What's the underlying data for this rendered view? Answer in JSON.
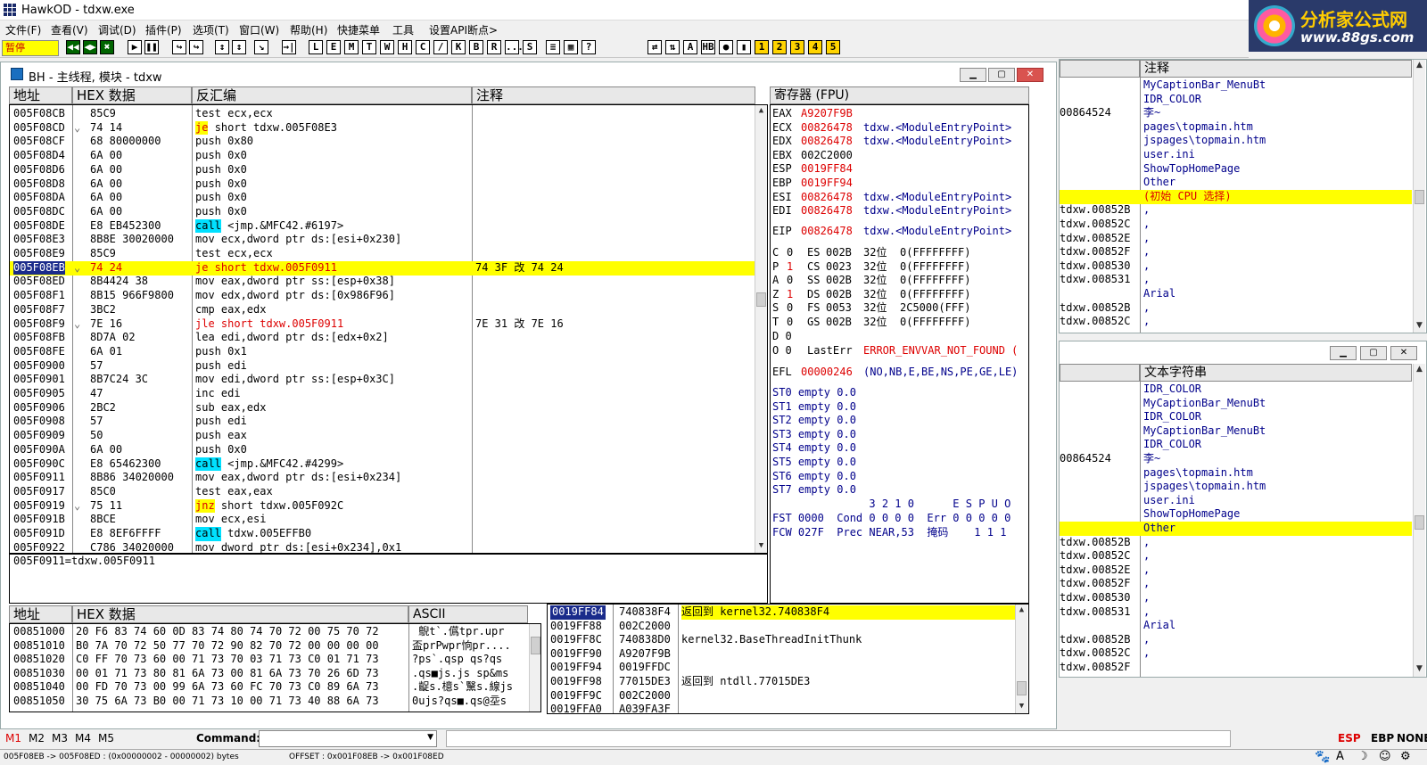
{
  "app": {
    "title": "HawkOD - tdxw.exe"
  },
  "menu": [
    "文件(F)",
    "查看(V)",
    "调试(D)",
    "插件(P)",
    "选项(T)",
    "窗口(W)",
    "帮助(H)",
    "快捷菜单",
    "工具",
    "设置API断点>"
  ],
  "toolbar": {
    "pause_label": "暂停",
    "buttons": [
      "◀◀",
      "◀▶",
      "✖",
      "▶",
      "❚❚",
      "↪",
      "↪",
      "↕",
      "↕",
      "↘",
      "→|",
      "L",
      "E",
      "M",
      "T",
      "W",
      "H",
      "C",
      "/",
      "K",
      "B",
      "R",
      "...",
      "S",
      "≡",
      "▦",
      "?",
      "⇄",
      "⇅",
      "A",
      "HB",
      "●",
      "▮",
      "1",
      "2",
      "3",
      "4",
      "5"
    ]
  },
  "logo": {
    "text1": "分析家公式网",
    "text2": "www.88gs.com"
  },
  "cpu_window": {
    "title": "BH - 主线程, 模块 - tdxw",
    "disasm_headers": {
      "addr": "地址",
      "hex": "HEX 数据",
      "disasm": "反汇编",
      "comment": "注释"
    },
    "rows": [
      {
        "addr": "005F08CB",
        "hex": "85C9",
        "asm": "test ecx,ecx",
        "cmt": ""
      },
      {
        "addr": "005F08CD",
        "arrow": "⌄",
        "hex": "74 14",
        "mn": "je",
        "mnstyle": "jmp",
        "ops": "short tdxw.005F08E3",
        "cmt": ""
      },
      {
        "addr": "005F08CF",
        "hex": "68 80000000",
        "asm": "push 0x80",
        "cmt": ""
      },
      {
        "addr": "005F08D4",
        "hex": "6A 00",
        "asm": "push 0x0",
        "cmt": ""
      },
      {
        "addr": "005F08D6",
        "hex": "6A 00",
        "asm": "push 0x0",
        "cmt": ""
      },
      {
        "addr": "005F08D8",
        "hex": "6A 00",
        "asm": "push 0x0",
        "cmt": ""
      },
      {
        "addr": "005F08DA",
        "hex": "6A 00",
        "asm": "push 0x0",
        "cmt": ""
      },
      {
        "addr": "005F08DC",
        "hex": "6A 00",
        "asm": "push 0x0",
        "cmt": ""
      },
      {
        "addr": "005F08DE",
        "hex": "E8 EB452300",
        "mn": "call",
        "mnstyle": "call",
        "ops": "<jmp.&MFC42.#6197>",
        "cmt": ""
      },
      {
        "addr": "005F08E3",
        "hex": "8B8E 30020000",
        "asm": "mov ecx,dword ptr ds:[esi+0x230]",
        "cmt": ""
      },
      {
        "addr": "005F08E9",
        "hex": "85C9",
        "asm": "test ecx,ecx",
        "cmt": ""
      },
      {
        "addr": "005F08EB",
        "arrow": "⌄",
        "hex": "74 24",
        "asm": "je short tdxw.005F0911",
        "cmt": "74 3F 改 74 24",
        "highlight": true
      },
      {
        "addr": "005F08ED",
        "hex": "8B4424 38",
        "asm": "mov eax,dword ptr ss:[esp+0x38]",
        "cmt": ""
      },
      {
        "addr": "005F08F1",
        "hex": "8B15 966F9800",
        "asm": "mov edx,dword ptr ds:[0x986F96]",
        "cmt": ""
      },
      {
        "addr": "005F08F7",
        "hex": "3BC2",
        "asm": "cmp eax,edx",
        "cmt": ""
      },
      {
        "addr": "005F08F9",
        "arrow": "⌄",
        "hex": "7E 16",
        "asm": "jle short tdxw.005F0911",
        "cmt": "7E 31 改 7E 16",
        "redline": true
      },
      {
        "addr": "005F08FB",
        "hex": "8D7A 02",
        "asm": "lea edi,dword ptr ds:[edx+0x2]",
        "cmt": ""
      },
      {
        "addr": "005F08FE",
        "hex": "6A 01",
        "asm": "push 0x1",
        "cmt": ""
      },
      {
        "addr": "005F0900",
        "hex": "57",
        "asm": "push edi",
        "cmt": ""
      },
      {
        "addr": "005F0901",
        "hex": "8B7C24 3C",
        "asm": "mov edi,dword ptr ss:[esp+0x3C]",
        "cmt": ""
      },
      {
        "addr": "005F0905",
        "hex": "47",
        "asm": "inc edi",
        "cmt": ""
      },
      {
        "addr": "005F0906",
        "hex": "2BC2",
        "asm": "sub eax,edx",
        "cmt": ""
      },
      {
        "addr": "005F0908",
        "hex": "57",
        "asm": "push edi",
        "cmt": ""
      },
      {
        "addr": "005F0909",
        "hex": "50",
        "asm": "push eax",
        "cmt": ""
      },
      {
        "addr": "005F090A",
        "hex": "6A 00",
        "asm": "push 0x0",
        "cmt": ""
      },
      {
        "addr": "005F090C",
        "hex": "E8 65462300",
        "mn": "call",
        "mnstyle": "call",
        "ops": "<jmp.&MFC42.#4299>",
        "cmt": ""
      },
      {
        "addr": "005F0911",
        "hex": "8B86 34020000",
        "asm": "mov eax,dword ptr ds:[esi+0x234]",
        "cmt": ""
      },
      {
        "addr": "005F0917",
        "hex": "85C0",
        "asm": "test eax,eax",
        "cmt": ""
      },
      {
        "addr": "005F0919",
        "arrow": "⌄",
        "hex": "75 11",
        "mn": "jnz",
        "mnstyle": "jmp",
        "ops": "short tdxw.005F092C",
        "cmt": ""
      },
      {
        "addr": "005F091B",
        "hex": "8BCE",
        "asm": "mov ecx,esi",
        "cmt": ""
      },
      {
        "addr": "005F091D",
        "hex": "E8 8EF6FFFF",
        "mn": "call",
        "mnstyle": "call",
        "ops": "tdxw.005EFFB0",
        "cmt": ""
      },
      {
        "addr": "005F0922",
        "hex": "C786 34020000",
        "asm": "mov dword ptr ds:[esi+0x234],0x1",
        "cmt": ""
      }
    ],
    "info_line": "005F0911=tdxw.005F0911",
    "reg_header": "寄存器 (FPU)",
    "regs": [
      {
        "n": "EAX",
        "v": "A9207F9B",
        "d": ""
      },
      {
        "n": "ECX",
        "v": "00826478",
        "d": "tdxw.<ModuleEntryPoint>"
      },
      {
        "n": "EDX",
        "v": "00826478",
        "d": "tdxw.<ModuleEntryPoint>"
      },
      {
        "n": "EBX",
        "v": "002C2000",
        "d": "",
        "black": true
      },
      {
        "n": "ESP",
        "v": "0019FF84",
        "d": ""
      },
      {
        "n": "EBP",
        "v": "0019FF94",
        "d": ""
      },
      {
        "n": "ESI",
        "v": "00826478",
        "d": "tdxw.<ModuleEntryPoint>"
      },
      {
        "n": "EDI",
        "v": "00826478",
        "d": "tdxw.<ModuleEntryPoint>"
      }
    ],
    "eip": {
      "n": "EIP",
      "v": "00826478",
      "d": "tdxw.<ModuleEntryPoint>"
    },
    "segs": [
      {
        "f": "C",
        "fv": "0",
        "s": "ES",
        "sv": "002B",
        "b": "32位",
        "r": "0(FFFFFFFF)"
      },
      {
        "f": "P",
        "fv": "1",
        "s": "CS",
        "sv": "0023",
        "b": "32位",
        "r": "0(FFFFFFFF)",
        "red": true
      },
      {
        "f": "A",
        "fv": "0",
        "s": "SS",
        "sv": "002B",
        "b": "32位",
        "r": "0(FFFFFFFF)"
      },
      {
        "f": "Z",
        "fv": "1",
        "s": "DS",
        "sv": "002B",
        "b": "32位",
        "r": "0(FFFFFFFF)",
        "red": true
      },
      {
        "f": "S",
        "fv": "0",
        "s": "FS",
        "sv": "0053",
        "b": "32位",
        "r": "2C5000(FFF)"
      },
      {
        "f": "T",
        "fv": "0",
        "s": "GS",
        "sv": "002B",
        "b": "32位",
        "r": "0(FFFFFFFF)"
      }
    ],
    "flag_d": "D 0",
    "flag_o": "O 0",
    "lasterr": {
      "label": "LastErr",
      "value": "ERROR_ENVVAR_NOT_FOUND ("
    },
    "efl": {
      "label": "EFL",
      "value": "00000246",
      "desc": "(NO,NB,E,BE,NS,PE,GE,LE)"
    },
    "st": [
      "ST0 empty 0.0",
      "ST1 empty 0.0",
      "ST2 empty 0.0",
      "ST3 empty 0.0",
      "ST4 empty 0.0",
      "ST5 empty 0.0",
      "ST6 empty 0.0",
      "ST7 empty 0.0"
    ],
    "fpu1": "               3 2 1 0      E S P U O",
    "fst": "FST 0000  Cond 0 0 0 0  Err 0 0 0 0 0",
    "fcw": "FCW 027F  Prec NEAR,53  掩码    1 1 1",
    "dump_headers": {
      "addr": "地址",
      "hex": "HEX 数据",
      "ascii": "ASCII"
    },
    "dump": [
      {
        "a": "00851000",
        "h": "20 F6 83 74 60 0D 83 74 80 74 70 72 00 75 70 72",
        "s": " 鶃t`.儰tpr.upr"
      },
      {
        "a": "00851010",
        "h": "B0 7A 70 72 50 77 70 72 90 82 70 72 00 00 00 00",
        "s": "盃prPwpr恦pr...."
      },
      {
        "a": "00851020",
        "h": "C0 FF 70 73 60 00 71 73 70 03 71 73 C0 01 71 73",
        "s": "?ps`.qsp qs?qs"
      },
      {
        "a": "00851030",
        "h": "00 01 71 73 80 81 6A 73 00 81 6A 73 70 26 6D 73",
        "s": ".qs■js.js sp&ms"
      },
      {
        "a": "00851040",
        "h": "00 FD 70 73 00 99 6A 73 60 FC 70 73 C0 89 6A 73",
        "s": ".齪s.檍s`黳s.線js"
      },
      {
        "a": "00851050",
        "h": "30 75 6A 73 B0 00 71 73 10 00 71 73 40 88 6A 73",
        "s": "0ujs?qs■.qs@坖s"
      }
    ],
    "stack": [
      {
        "a": "0019FF84",
        "v": "740838F4",
        "c": "返回到 kernel32.740838F4",
        "cur": true
      },
      {
        "a": "0019FF88",
        "v": "002C2000",
        "c": ""
      },
      {
        "a": "0019FF8C",
        "v": "740838D0",
        "c": "kernel32.BaseThreadInitThunk"
      },
      {
        "a": "0019FF90",
        "v": "A9207F9B",
        "c": ""
      },
      {
        "a": "0019FF94",
        "v": "0019FFDC",
        "c": ""
      },
      {
        "a": "0019FF98",
        "v": "77015DE3",
        "c": "返回到 ntdll.77015DE3"
      },
      {
        "a": "0019FF9C",
        "v": "002C2000",
        "c": ""
      },
      {
        "a": "0019FFA0",
        "v": "A039FA3F",
        "c": ""
      }
    ]
  },
  "right_top": {
    "header": "注释",
    "rows": [
      {
        "l": "",
        "r": "MyCaptionBar_MenuBt"
      },
      {
        "l": "",
        "r": "IDR_COLOR"
      },
      {
        "l": "00864524",
        "r": "李~"
      },
      {
        "l": "",
        "r": "pages\\topmain.htm"
      },
      {
        "l": "",
        "r": "jspages\\topmain.htm"
      },
      {
        "l": "",
        "r": "user.ini"
      },
      {
        "l": "",
        "r": "ShowTopHomePage"
      },
      {
        "l": "",
        "r": "Other"
      },
      {
        "l": "",
        "r": "(初始 CPU 选择)",
        "hl": true,
        "red": true
      },
      {
        "l": "tdxw.00852B",
        "r": ","
      },
      {
        "l": "tdxw.00852C",
        "r": ","
      },
      {
        "l": "tdxw.00852E",
        "r": ","
      },
      {
        "l": "tdxw.00852F",
        "r": ","
      },
      {
        "l": "tdxw.008530",
        "r": ","
      },
      {
        "l": "tdxw.008531",
        "r": ","
      },
      {
        "l": "",
        "r": "Arial"
      },
      {
        "l": "tdxw.00852B",
        "r": ","
      },
      {
        "l": "tdxw.00852C",
        "r": ","
      }
    ]
  },
  "right_bottom": {
    "header": "文本字符串",
    "rows": [
      {
        "l": "",
        "r": "IDR_COLOR"
      },
      {
        "l": "",
        "r": "MyCaptionBar_MenuBt"
      },
      {
        "l": "",
        "r": "IDR_COLOR"
      },
      {
        "l": "",
        "r": "MyCaptionBar_MenuBt"
      },
      {
        "l": "",
        "r": "IDR_COLOR"
      },
      {
        "l": "00864524",
        "r": "李~"
      },
      {
        "l": "",
        "r": "pages\\topmain.htm"
      },
      {
        "l": "",
        "r": "jspages\\topmain.htm"
      },
      {
        "l": "",
        "r": "user.ini"
      },
      {
        "l": "",
        "r": "ShowTopHomePage"
      },
      {
        "l": "",
        "r": "Other",
        "hl": true
      },
      {
        "l": "tdxw.00852B",
        "r": ","
      },
      {
        "l": "tdxw.00852C",
        "r": ","
      },
      {
        "l": "tdxw.00852E",
        "r": ","
      },
      {
        "l": "tdxw.00852F",
        "r": ","
      },
      {
        "l": "tdxw.008530",
        "r": ","
      },
      {
        "l": "tdxw.008531",
        "r": ","
      },
      {
        "l": "",
        "r": "Arial"
      },
      {
        "l": "tdxw.00852B",
        "r": ","
      },
      {
        "l": "tdxw.00852C",
        "r": ","
      },
      {
        "l": "tdxw.00852F",
        "r": ""
      }
    ]
  },
  "command": {
    "tabs": [
      "M1",
      "M2",
      "M3",
      "M4",
      "M5"
    ],
    "label": "Command:",
    "value": "",
    "esp": "ESP",
    "ebp": "EBP",
    "none": "NONE"
  },
  "status": {
    "left": "005F08EB -> 005F08ED : (0x00000002 - 00000002) bytes",
    "right": "OFFSET : 0x001F08EB -> 0x001F08ED"
  }
}
